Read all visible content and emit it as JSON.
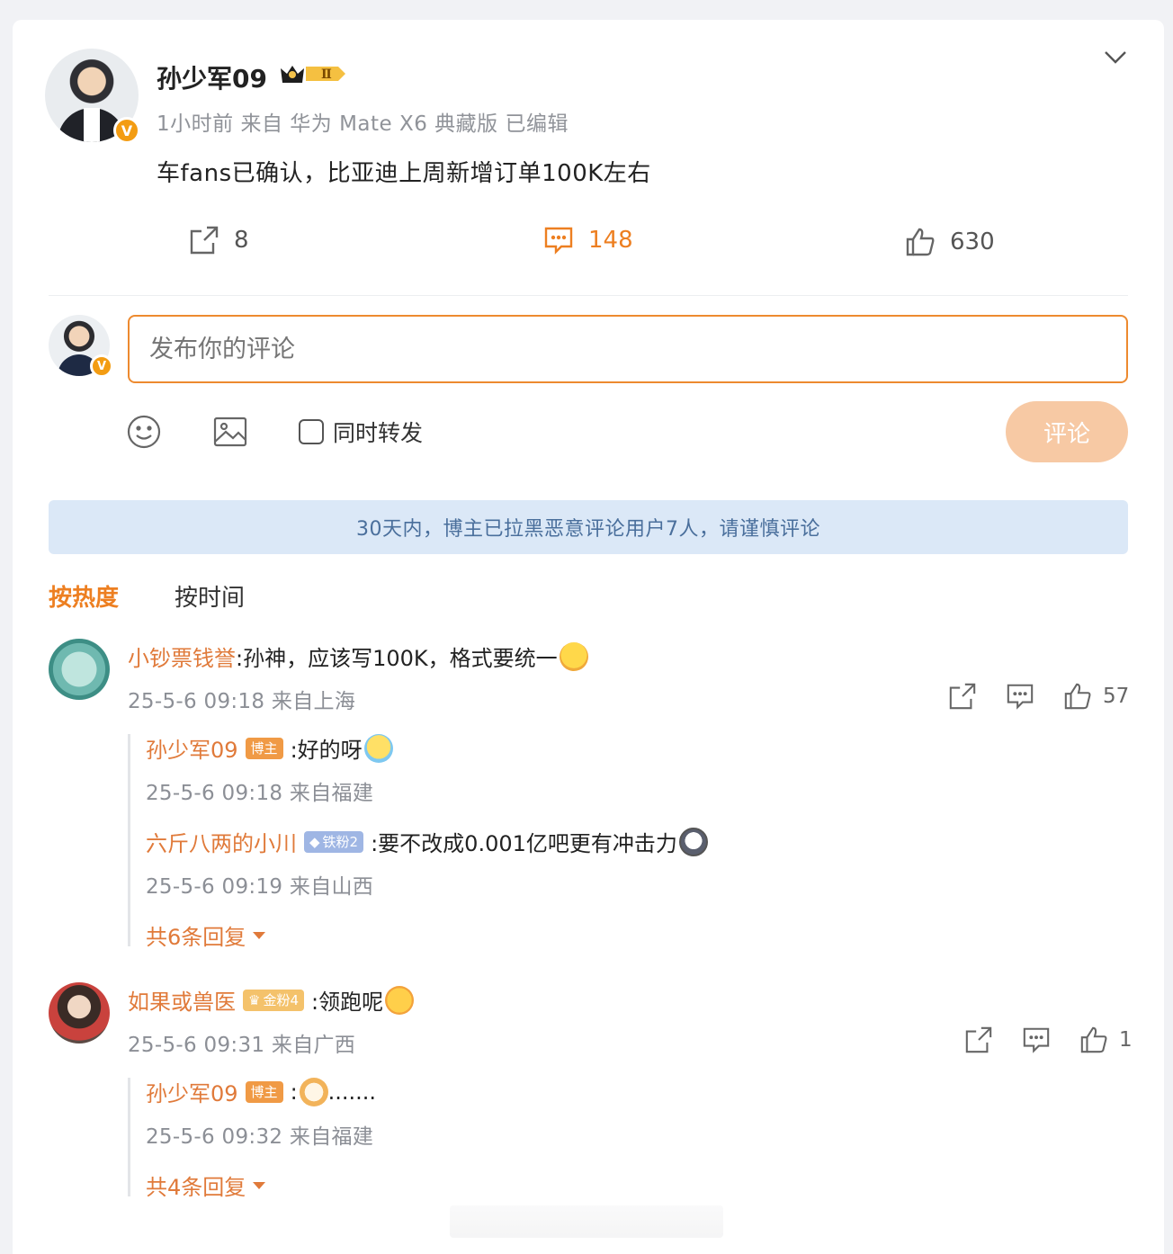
{
  "post": {
    "author": "孙少军09",
    "level_badge": "Ⅱ",
    "verified_badge": "V",
    "meta": "1小时前  来自 华为 Mate X6 典藏版 已编辑",
    "text": "车fans已确认，比亚迪上周新增订单100K左右",
    "repost_count": "8",
    "comment_count": "148",
    "like_count": "630"
  },
  "composer": {
    "placeholder": "发布你的评论",
    "repost_label": "同时转发",
    "submit_label": "评论",
    "verified_badge": "V"
  },
  "notice": "30天内，博主已拉黑恶意评论用户7人，请谨慎评论",
  "sort": {
    "hot": "按热度",
    "time": "按时间"
  },
  "comments": [
    {
      "user": "小钞票钱誉",
      "text": ":孙神，应该写100K，格式要统一",
      "time": "25-5-6 09:18 来自上海",
      "like_count": "57",
      "replies": [
        {
          "user": "孙少军09",
          "tag": "博主",
          "text": ":好的呀",
          "time": "25-5-6 09:18 来自福建"
        },
        {
          "user": "六斤八两的小川",
          "tag": "铁粉2",
          "text": ":要不改成0.001亿吧更有冲击力",
          "time": "25-5-6 09:19 来自山西"
        }
      ],
      "more_replies": "共6条回复"
    },
    {
      "user": "如果或兽医",
      "tag": "金粉4",
      "text": ":领跑呢",
      "time": "25-5-6 09:31 来自广西",
      "like_count": "1",
      "replies": [
        {
          "user": "孙少军09",
          "tag": "博主",
          "text": ":",
          "text_after": ".......",
          "time": "25-5-6 09:32 来自福建"
        }
      ],
      "more_replies": "共4条回复"
    }
  ],
  "icons": {
    "menu": "chevron-down-icon",
    "repost": "share-icon",
    "comment": "comment-icon",
    "like": "thumbs-up-icon",
    "emoji": "smiley-icon",
    "image": "image-icon"
  },
  "colors": {
    "accent": "#ed7f21",
    "notice_bg": "#dbe8f7",
    "notice_text": "#4a6f9c",
    "submit_disabled": "#f7c9a4"
  }
}
